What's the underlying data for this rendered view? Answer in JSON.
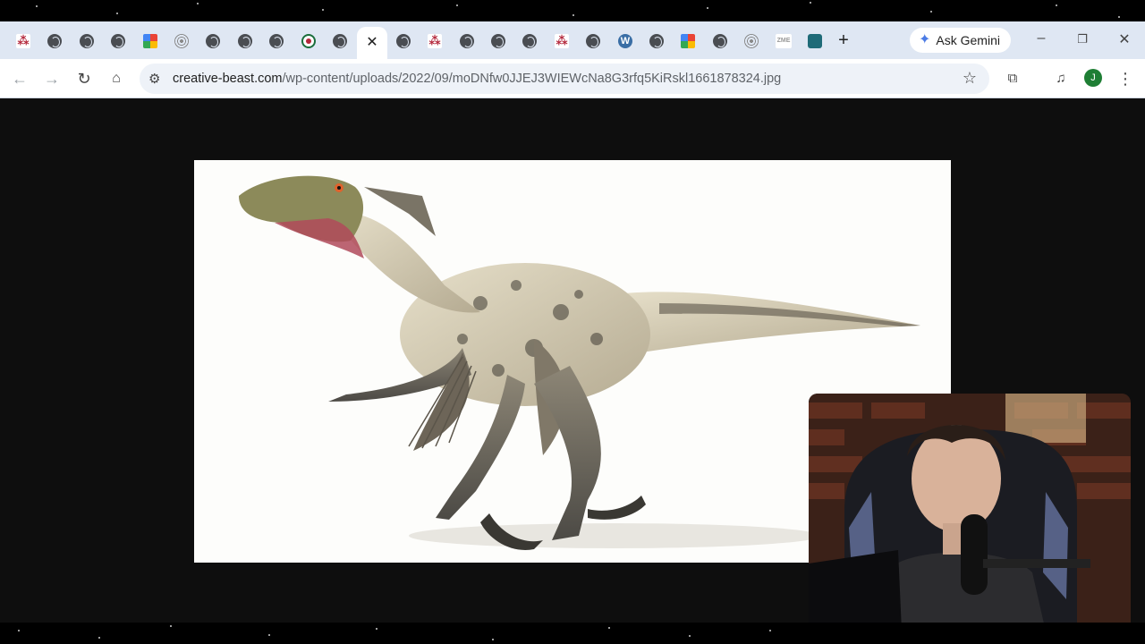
{
  "browser": {
    "tabs": [
      {
        "icon": "rsc-icon"
      },
      {
        "icon": "globe-icon"
      },
      {
        "icon": "globe-icon"
      },
      {
        "icon": "globe-icon"
      },
      {
        "icon": "google-photos-icon"
      },
      {
        "icon": "target-icon"
      },
      {
        "icon": "globe-icon"
      },
      {
        "icon": "globe-icon"
      },
      {
        "icon": "globe-icon"
      },
      {
        "icon": "wikimedia-icon"
      },
      {
        "icon": "globe-icon"
      },
      {
        "icon": "close-icon",
        "active": true
      },
      {
        "icon": "globe-icon"
      },
      {
        "icon": "rsc-icon"
      },
      {
        "icon": "globe-icon"
      },
      {
        "icon": "globe-icon"
      },
      {
        "icon": "globe-icon"
      },
      {
        "icon": "rsc-icon"
      },
      {
        "icon": "globe-icon"
      },
      {
        "icon": "wordpress-icon"
      },
      {
        "icon": "globe-icon"
      },
      {
        "icon": "google-photos-icon"
      },
      {
        "icon": "globe-icon"
      },
      {
        "icon": "target-icon"
      },
      {
        "icon": "zme-icon"
      },
      {
        "icon": "bird-icon"
      }
    ],
    "new_tab_symbol": "+",
    "gemini_label": "Ask Gemini",
    "url_host": "creative-beast.com",
    "url_path": "/wp-content/uploads/2022/09/moDNfw0JJEJ3WIEWcNa8G3rfq5KiRskl1661878324.jpg",
    "profile_initial": "J"
  },
  "content": {
    "image_subject": "feathered raptor dinosaur",
    "overlay": "webcam"
  },
  "colors": {
    "tabstrip": "#dfe7f3",
    "background": "#0e0e0e",
    "accent": "#4b7be5"
  }
}
